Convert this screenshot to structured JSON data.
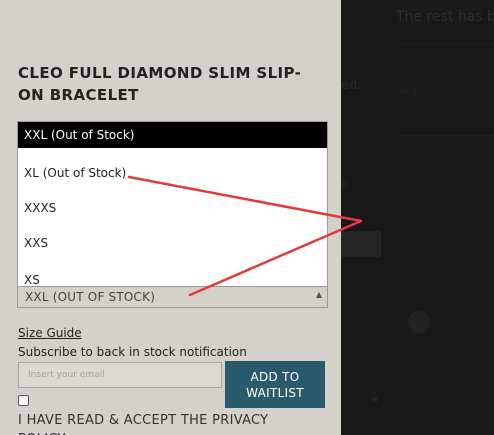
{
  "background": {
    "heading": "The rest has be",
    "faint_1": "ed.",
    "faint_2": "ilog",
    "faint_3": "a"
  },
  "product": {
    "title": "CLEO FULL DIAMOND SLIM SLIP-ON BRACELET"
  },
  "size_select": {
    "options": [
      {
        "label": "XXL (Out of Stock)",
        "selected": true
      },
      {
        "label": "XL (Out of Stock)",
        "selected": false
      },
      {
        "label": "XXXS",
        "selected": false
      },
      {
        "label": "XXS",
        "selected": false
      },
      {
        "label": "XS",
        "selected": false
      }
    ],
    "value": "XXL (OUT OF STOCK)",
    "arrow": "▲"
  },
  "size_guide": "Size Guide",
  "subscribe_text": "Subscribe to back in stock notification",
  "email": {
    "placeholder": "Insert your email",
    "value": ""
  },
  "waitlist_button": "ADD TO WAITLIST",
  "privacy_text": "I HAVE READ & ACCEPT THE PRIVACY POLICY",
  "colors": {
    "panel_bg": "#d4d1cb",
    "button_bg": "#2a5b6d",
    "selected_option_bg": "#000000",
    "annotation": "#e63a3a",
    "overlay": "#1b1b1b"
  }
}
